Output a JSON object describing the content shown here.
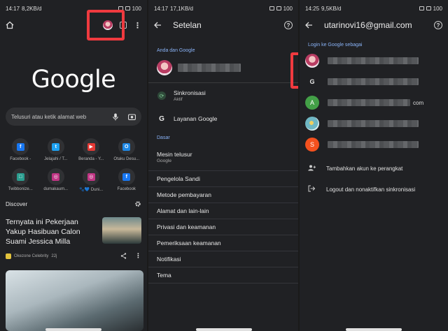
{
  "panel1": {
    "status": {
      "time": "14:17",
      "speed": "8,2KB/d",
      "battery": "100"
    },
    "logo": "Google",
    "search_placeholder": "Telusuri atau ketik alamat web",
    "shortcuts": [
      {
        "label": "Facebook -",
        "color": "#1877f2",
        "glyph": "f"
      },
      {
        "label": "Jelajahi / T...",
        "color": "#1da1f2",
        "glyph": "t"
      },
      {
        "label": "Beranda - Y...",
        "color": "#e53935",
        "glyph": "▶"
      },
      {
        "label": "Otaku Desu...",
        "color": "#1e88e5",
        "glyph": "O"
      },
      {
        "label": "Twibbonize...",
        "color": "#2a9d8f",
        "glyph": "□"
      },
      {
        "label": "dumakaum...",
        "color": "#c13584",
        "glyph": "◎"
      },
      {
        "label": "🐾💙 Duni...",
        "color": "#c13584",
        "glyph": "◎"
      },
      {
        "label": "Facebook",
        "color": "#1877f2",
        "glyph": "f"
      }
    ],
    "discover_label": "Discover",
    "article": {
      "title": "Ternyata ini Pekerjaan Yakup Hasibuan Calon Suami Jessica Milla",
      "source": "Okezone Celebrity",
      "age": "22j"
    }
  },
  "panel2": {
    "status": {
      "time": "14:17",
      "speed": "17,1KB/d",
      "battery": "100"
    },
    "title": "Setelan",
    "section_google": "Anda dan Google",
    "sync_label": "Sinkronisasi",
    "sync_status": "Aktif",
    "google_services": "Layanan Google",
    "section_basic": "Dasar",
    "search_engine": "Mesin telusur",
    "search_engine_value": "Google",
    "items": [
      "Pengelola Sandi",
      "Metode pembayaran",
      "Alamat dan lain-lain",
      "Privasi dan keamanan",
      "Pemeriksaan keamanan",
      "Notifikasi",
      "Tema"
    ]
  },
  "panel3": {
    "status": {
      "time": "14:25",
      "speed": "9,5KB/d",
      "battery": "100"
    },
    "title": "utarinovi16@gmail.com",
    "section_login": "Login ke Google sebagai",
    "accounts": [
      {
        "type": "photo",
        "letter": "",
        "color": "#b93d63",
        "suffix": ""
      },
      {
        "type": "google",
        "letter": "G",
        "color": "#202124",
        "suffix": ""
      },
      {
        "type": "letter",
        "letter": "A",
        "color": "#43a047",
        "suffix": "com"
      },
      {
        "type": "photo2",
        "letter": "",
        "color": "#6fb7c4",
        "suffix": ""
      },
      {
        "type": "letter",
        "letter": "S",
        "color": "#f4511e",
        "suffix": ""
      }
    ],
    "add_account": "Tambahkan akun ke perangkat",
    "logout": "Logout dan nonaktifkan sinkronisasi"
  }
}
